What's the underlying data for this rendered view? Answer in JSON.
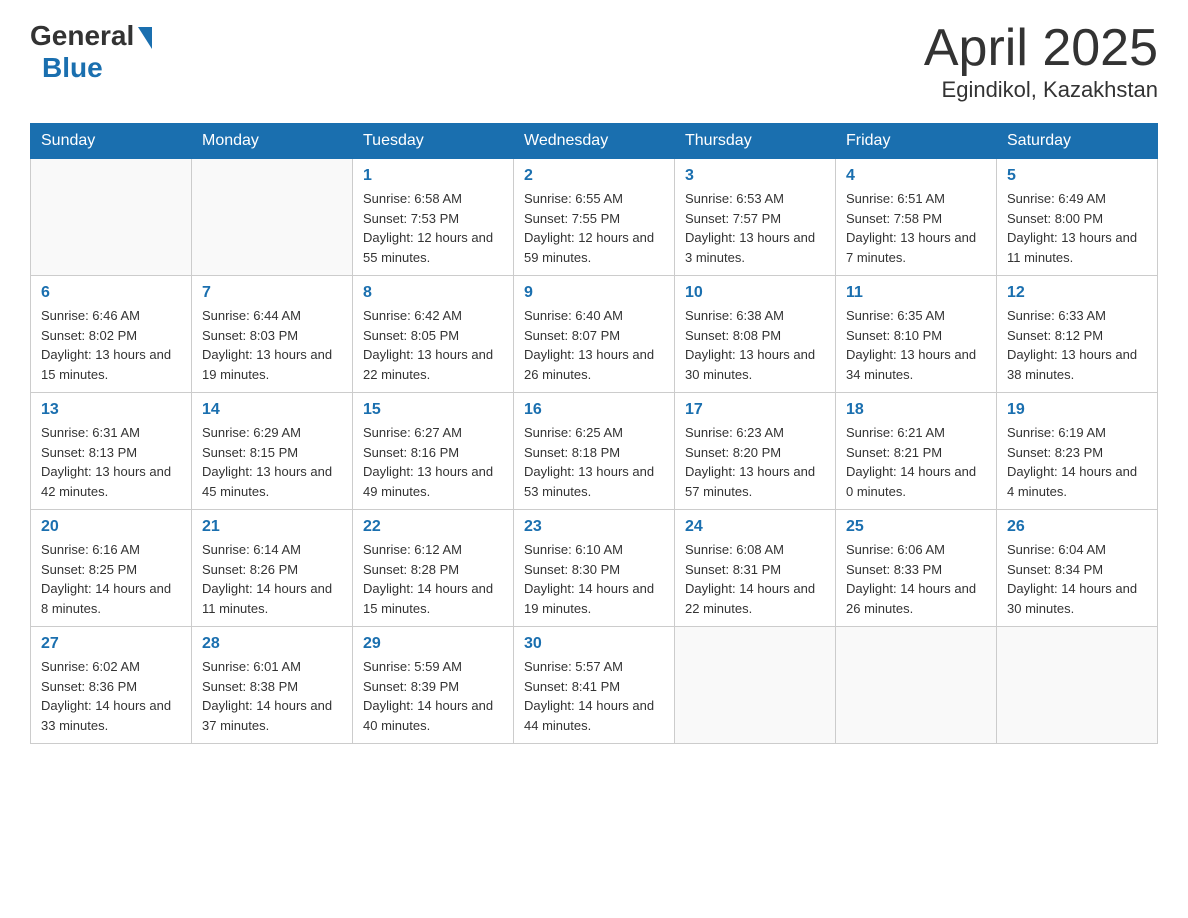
{
  "header": {
    "logo_general": "General",
    "logo_blue": "Blue",
    "month_title": "April 2025",
    "location": "Egindikol, Kazakhstan"
  },
  "weekdays": [
    "Sunday",
    "Monday",
    "Tuesday",
    "Wednesday",
    "Thursday",
    "Friday",
    "Saturday"
  ],
  "weeks": [
    [
      {
        "day": "",
        "sunrise": "",
        "sunset": "",
        "daylight": ""
      },
      {
        "day": "",
        "sunrise": "",
        "sunset": "",
        "daylight": ""
      },
      {
        "day": "1",
        "sunrise": "Sunrise: 6:58 AM",
        "sunset": "Sunset: 7:53 PM",
        "daylight": "Daylight: 12 hours and 55 minutes."
      },
      {
        "day": "2",
        "sunrise": "Sunrise: 6:55 AM",
        "sunset": "Sunset: 7:55 PM",
        "daylight": "Daylight: 12 hours and 59 minutes."
      },
      {
        "day": "3",
        "sunrise": "Sunrise: 6:53 AM",
        "sunset": "Sunset: 7:57 PM",
        "daylight": "Daylight: 13 hours and 3 minutes."
      },
      {
        "day": "4",
        "sunrise": "Sunrise: 6:51 AM",
        "sunset": "Sunset: 7:58 PM",
        "daylight": "Daylight: 13 hours and 7 minutes."
      },
      {
        "day": "5",
        "sunrise": "Sunrise: 6:49 AM",
        "sunset": "Sunset: 8:00 PM",
        "daylight": "Daylight: 13 hours and 11 minutes."
      }
    ],
    [
      {
        "day": "6",
        "sunrise": "Sunrise: 6:46 AM",
        "sunset": "Sunset: 8:02 PM",
        "daylight": "Daylight: 13 hours and 15 minutes."
      },
      {
        "day": "7",
        "sunrise": "Sunrise: 6:44 AM",
        "sunset": "Sunset: 8:03 PM",
        "daylight": "Daylight: 13 hours and 19 minutes."
      },
      {
        "day": "8",
        "sunrise": "Sunrise: 6:42 AM",
        "sunset": "Sunset: 8:05 PM",
        "daylight": "Daylight: 13 hours and 22 minutes."
      },
      {
        "day": "9",
        "sunrise": "Sunrise: 6:40 AM",
        "sunset": "Sunset: 8:07 PM",
        "daylight": "Daylight: 13 hours and 26 minutes."
      },
      {
        "day": "10",
        "sunrise": "Sunrise: 6:38 AM",
        "sunset": "Sunset: 8:08 PM",
        "daylight": "Daylight: 13 hours and 30 minutes."
      },
      {
        "day": "11",
        "sunrise": "Sunrise: 6:35 AM",
        "sunset": "Sunset: 8:10 PM",
        "daylight": "Daylight: 13 hours and 34 minutes."
      },
      {
        "day": "12",
        "sunrise": "Sunrise: 6:33 AM",
        "sunset": "Sunset: 8:12 PM",
        "daylight": "Daylight: 13 hours and 38 minutes."
      }
    ],
    [
      {
        "day": "13",
        "sunrise": "Sunrise: 6:31 AM",
        "sunset": "Sunset: 8:13 PM",
        "daylight": "Daylight: 13 hours and 42 minutes."
      },
      {
        "day": "14",
        "sunrise": "Sunrise: 6:29 AM",
        "sunset": "Sunset: 8:15 PM",
        "daylight": "Daylight: 13 hours and 45 minutes."
      },
      {
        "day": "15",
        "sunrise": "Sunrise: 6:27 AM",
        "sunset": "Sunset: 8:16 PM",
        "daylight": "Daylight: 13 hours and 49 minutes."
      },
      {
        "day": "16",
        "sunrise": "Sunrise: 6:25 AM",
        "sunset": "Sunset: 8:18 PM",
        "daylight": "Daylight: 13 hours and 53 minutes."
      },
      {
        "day": "17",
        "sunrise": "Sunrise: 6:23 AM",
        "sunset": "Sunset: 8:20 PM",
        "daylight": "Daylight: 13 hours and 57 minutes."
      },
      {
        "day": "18",
        "sunrise": "Sunrise: 6:21 AM",
        "sunset": "Sunset: 8:21 PM",
        "daylight": "Daylight: 14 hours and 0 minutes."
      },
      {
        "day": "19",
        "sunrise": "Sunrise: 6:19 AM",
        "sunset": "Sunset: 8:23 PM",
        "daylight": "Daylight: 14 hours and 4 minutes."
      }
    ],
    [
      {
        "day": "20",
        "sunrise": "Sunrise: 6:16 AM",
        "sunset": "Sunset: 8:25 PM",
        "daylight": "Daylight: 14 hours and 8 minutes."
      },
      {
        "day": "21",
        "sunrise": "Sunrise: 6:14 AM",
        "sunset": "Sunset: 8:26 PM",
        "daylight": "Daylight: 14 hours and 11 minutes."
      },
      {
        "day": "22",
        "sunrise": "Sunrise: 6:12 AM",
        "sunset": "Sunset: 8:28 PM",
        "daylight": "Daylight: 14 hours and 15 minutes."
      },
      {
        "day": "23",
        "sunrise": "Sunrise: 6:10 AM",
        "sunset": "Sunset: 8:30 PM",
        "daylight": "Daylight: 14 hours and 19 minutes."
      },
      {
        "day": "24",
        "sunrise": "Sunrise: 6:08 AM",
        "sunset": "Sunset: 8:31 PM",
        "daylight": "Daylight: 14 hours and 22 minutes."
      },
      {
        "day": "25",
        "sunrise": "Sunrise: 6:06 AM",
        "sunset": "Sunset: 8:33 PM",
        "daylight": "Daylight: 14 hours and 26 minutes."
      },
      {
        "day": "26",
        "sunrise": "Sunrise: 6:04 AM",
        "sunset": "Sunset: 8:34 PM",
        "daylight": "Daylight: 14 hours and 30 minutes."
      }
    ],
    [
      {
        "day": "27",
        "sunrise": "Sunrise: 6:02 AM",
        "sunset": "Sunset: 8:36 PM",
        "daylight": "Daylight: 14 hours and 33 minutes."
      },
      {
        "day": "28",
        "sunrise": "Sunrise: 6:01 AM",
        "sunset": "Sunset: 8:38 PM",
        "daylight": "Daylight: 14 hours and 37 minutes."
      },
      {
        "day": "29",
        "sunrise": "Sunrise: 5:59 AM",
        "sunset": "Sunset: 8:39 PM",
        "daylight": "Daylight: 14 hours and 40 minutes."
      },
      {
        "day": "30",
        "sunrise": "Sunrise: 5:57 AM",
        "sunset": "Sunset: 8:41 PM",
        "daylight": "Daylight: 14 hours and 44 minutes."
      },
      {
        "day": "",
        "sunrise": "",
        "sunset": "",
        "daylight": ""
      },
      {
        "day": "",
        "sunrise": "",
        "sunset": "",
        "daylight": ""
      },
      {
        "day": "",
        "sunrise": "",
        "sunset": "",
        "daylight": ""
      }
    ]
  ]
}
